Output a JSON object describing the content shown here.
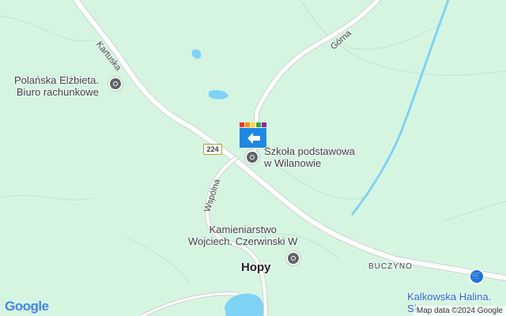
{
  "map": {
    "road_number": "224",
    "roads": {
      "kartuska": "Kartuska",
      "gorna": "Górna",
      "wspolna": "Wspólna"
    },
    "places": {
      "hopy": "Hopy",
      "buczyno": "BUCZYNO"
    },
    "pois": {
      "polanska_line1": "Polańska Elżbieta.",
      "polanska_line2": "Biuro rachunkowe",
      "school_line1": "Szkoła podstawowa",
      "school_line2": "w Wilanowie",
      "stone_line1": "Kamieniarstwo",
      "stone_line2": "Wojciech. Czerwinski W",
      "kalkowska_line1": "Kalkowska Halina.",
      "kalkowska_line2": "Sk"
    },
    "logo": "Google",
    "attribution": "Map data ©2024 Google",
    "colors": {
      "land": "#d6f5e1",
      "water": "#7fd3f5",
      "road": "#ffffff",
      "poi": "#5f6368",
      "shop": "#1a73e8"
    },
    "icons": [
      "place-of-interest-icon",
      "school-icon",
      "shopping-cart-icon"
    ]
  }
}
